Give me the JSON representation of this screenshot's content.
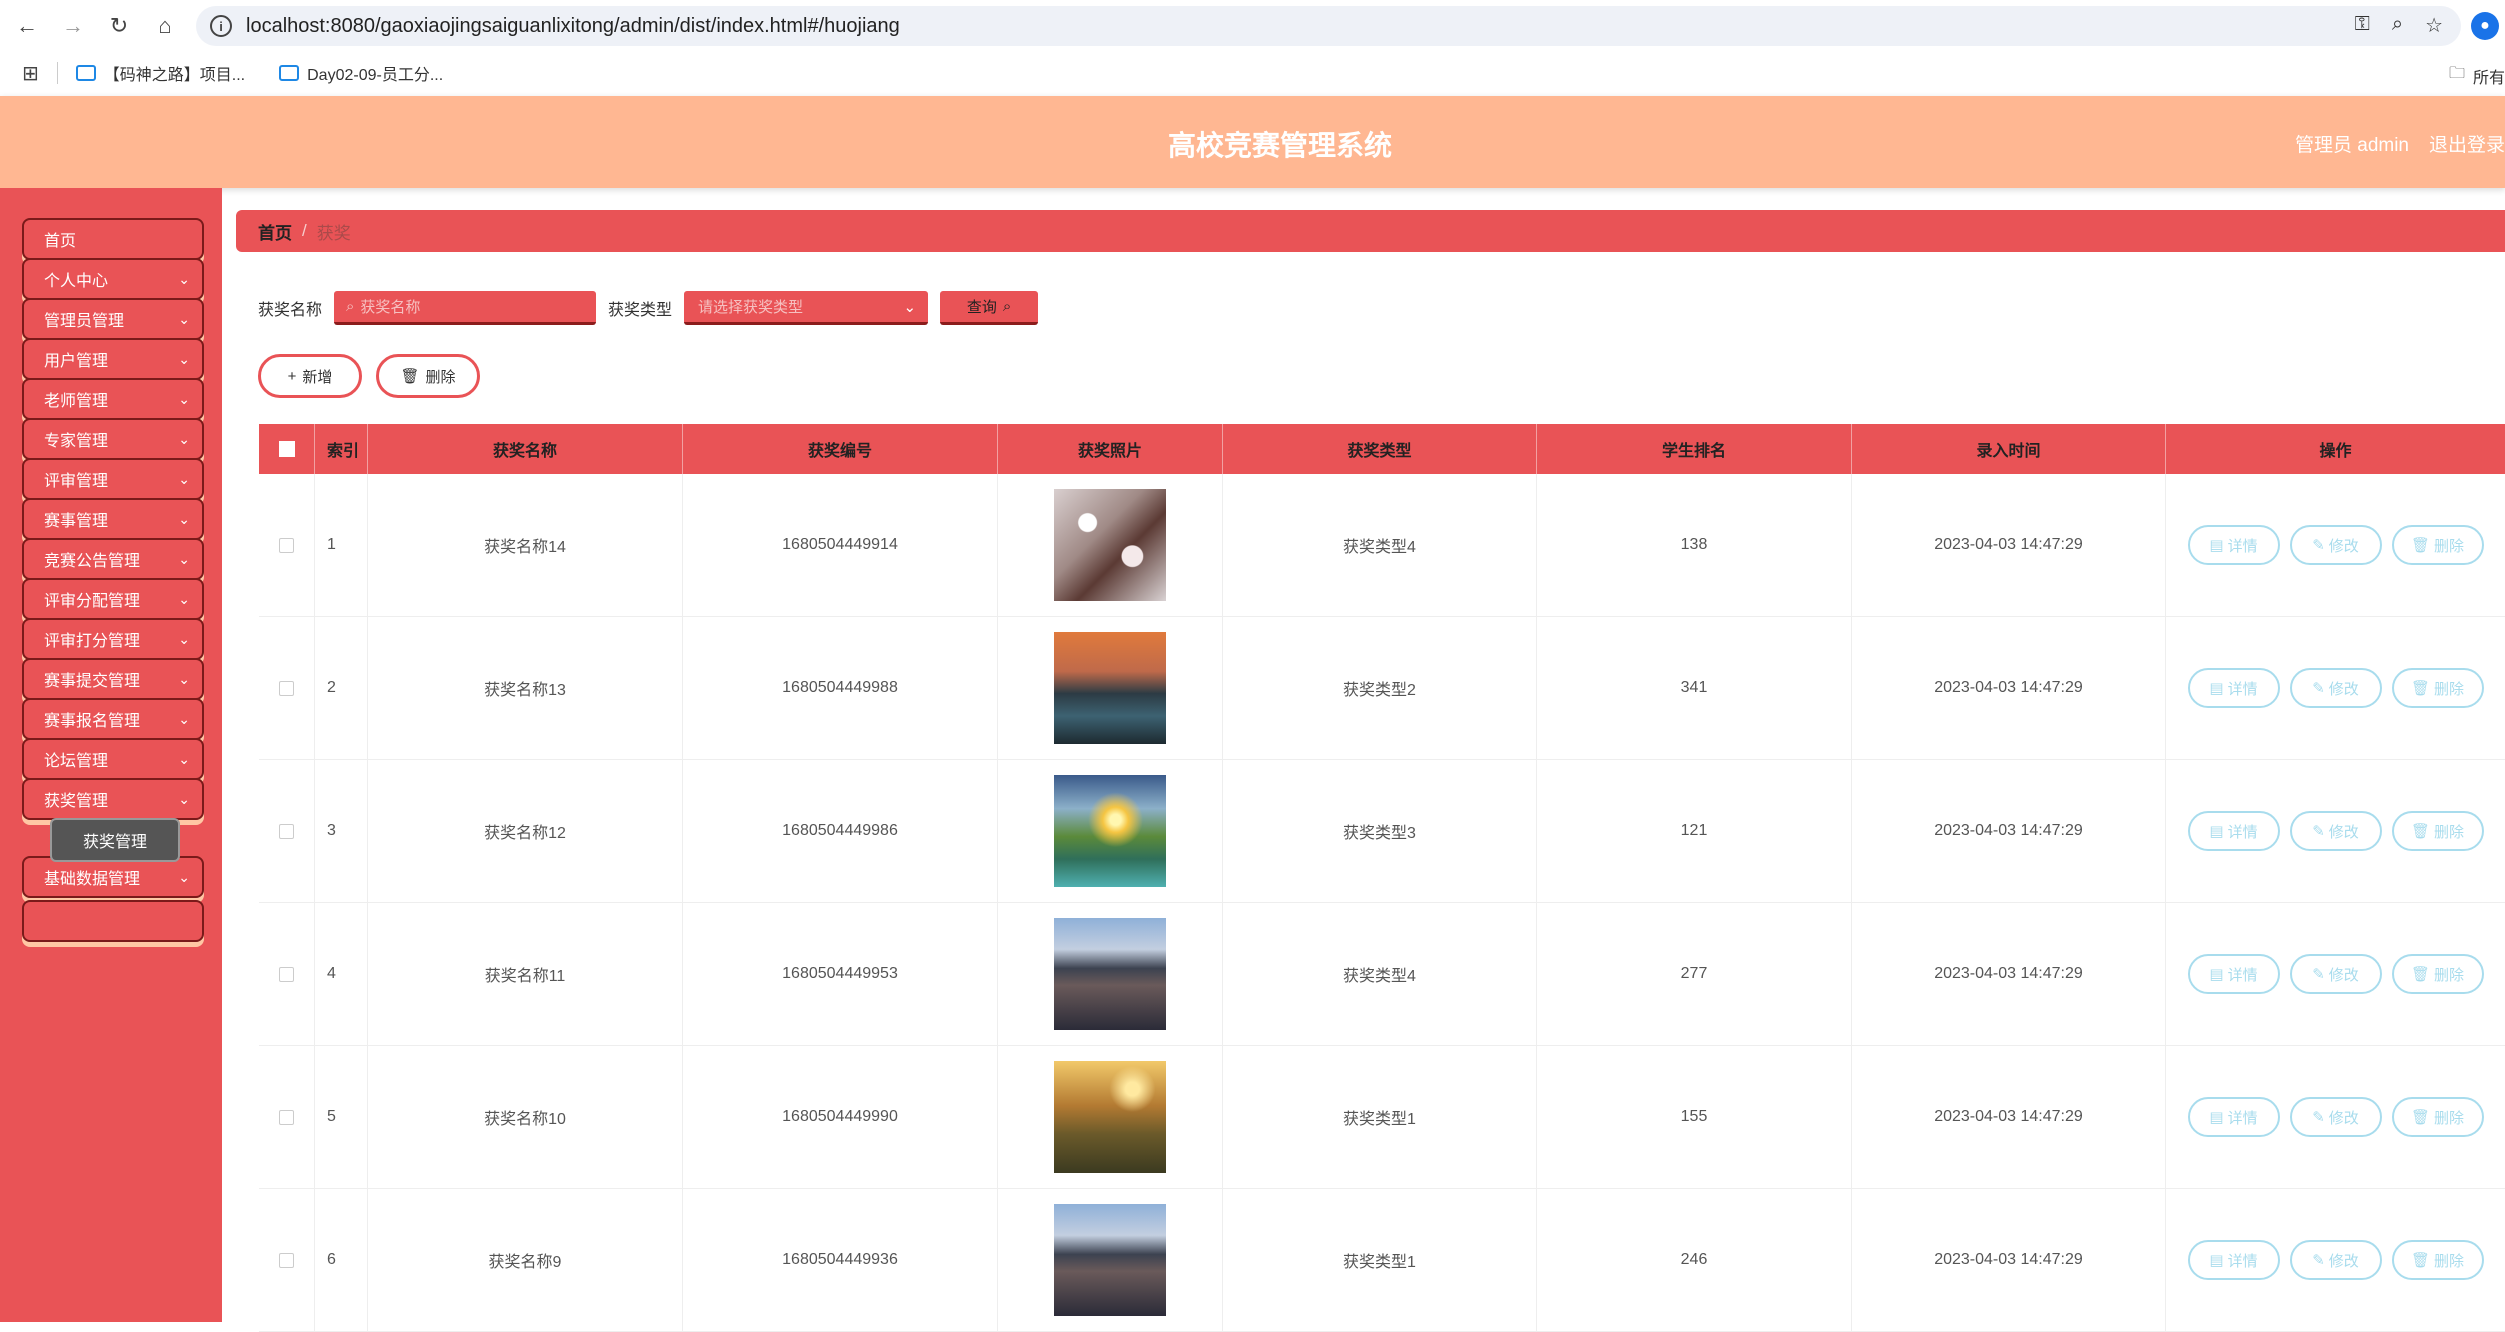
{
  "browser": {
    "url": "localhost:8080/gaoxiaojingsaiguanlixitong/admin/dist/index.html#/huojiang",
    "bookmarks": [
      "【码神之路】项目...",
      "Day02-09-员工分..."
    ],
    "all_bookmarks": "所有"
  },
  "header": {
    "title": "高校竞赛管理系统",
    "user": "管理员 admin",
    "logout": "退出登录"
  },
  "sidebar": {
    "items": [
      "首页",
      "个人中心",
      "管理员管理",
      "用户管理",
      "老师管理",
      "专家管理",
      "评审管理",
      "赛事管理",
      "竞赛公告管理",
      "评审分配管理",
      "评审打分管理",
      "赛事提交管理",
      "赛事报名管理",
      "论坛管理",
      "获奖管理",
      "基础数据管理"
    ],
    "active_sub": "获奖管理"
  },
  "breadcrumb": {
    "home": "首页",
    "sep": "/",
    "current": "获奖"
  },
  "search": {
    "name_label": "获奖名称",
    "name_placeholder": "获奖名称",
    "type_label": "获奖类型",
    "type_placeholder": "请选择获奖类型",
    "query_label": "查询"
  },
  "actions": {
    "add": "新增",
    "delete": "删除"
  },
  "table": {
    "headers": [
      "索引",
      "获奖名称",
      "获奖编号",
      "获奖照片",
      "获奖类型",
      "学生排名",
      "录入时间",
      "操作"
    ],
    "op_labels": {
      "detail": "详情",
      "edit": "修改",
      "delete": "删除"
    },
    "rows": [
      {
        "idx": "1",
        "name": "获奖名称14",
        "no": "1680504449914",
        "photo": "blossom",
        "type": "获奖类型4",
        "rank": "138",
        "time": "2023-04-03 14:47:29"
      },
      {
        "idx": "2",
        "name": "获奖名称13",
        "no": "1680504449988",
        "photo": "lake-sunset",
        "type": "获奖类型2",
        "rank": "341",
        "time": "2023-04-03 14:47:29"
      },
      {
        "idx": "3",
        "name": "获奖名称12",
        "no": "1680504449986",
        "photo": "sunrise-valley",
        "type": "获奖类型3",
        "rank": "121",
        "time": "2023-04-03 14:47:29"
      },
      {
        "idx": "4",
        "name": "获奖名称11",
        "no": "1680504449953",
        "photo": "fuji-city",
        "type": "获奖类型4",
        "rank": "277",
        "time": "2023-04-03 14:47:29"
      },
      {
        "idx": "5",
        "name": "获奖名称10",
        "no": "1680504449990",
        "photo": "hill-sunset",
        "type": "获奖类型1",
        "rank": "155",
        "time": "2023-04-03 14:47:29"
      },
      {
        "idx": "6",
        "name": "获奖名称9",
        "no": "1680504449936",
        "photo": "fuji-city",
        "type": "获奖类型1",
        "rank": "246",
        "time": "2023-04-03 14:47:29"
      }
    ]
  },
  "colors": {
    "primary": "#e95356",
    "header": "#ffb792",
    "op_border": "#a8dced"
  }
}
